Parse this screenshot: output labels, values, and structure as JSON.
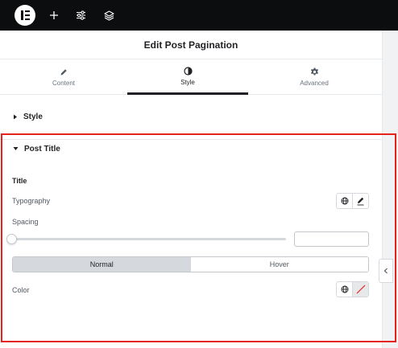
{
  "topbar": {
    "icons": [
      "elementor-logo-icon",
      "plus-icon",
      "sliders-icon",
      "layers-icon"
    ],
    "background": "#0c0d0e"
  },
  "panel": {
    "title": "Edit Post Pagination",
    "tabs": [
      {
        "label": "Content",
        "icon": "pencil-icon",
        "active": false
      },
      {
        "label": "Style",
        "icon": "contrast-icon",
        "active": true
      },
      {
        "label": "Advanced",
        "icon": "gear-icon",
        "active": false
      }
    ]
  },
  "sections": {
    "style": {
      "label": "Style",
      "expanded": false
    },
    "post_title": {
      "label": "Post Title",
      "expanded": true
    }
  },
  "controls": {
    "heading": "Title",
    "typography_label": "Typography",
    "spacing_label": "Spacing",
    "spacing_value": "",
    "spacing_slider_level": 0,
    "state_tabs": [
      {
        "label": "Normal",
        "active": true
      },
      {
        "label": "Hover",
        "active": false
      }
    ],
    "color_label": "Color"
  },
  "colors": {
    "highlight": "#e5231c",
    "active_tab_underline": "#1f2124",
    "switcher_active": "#d5d8dc"
  }
}
